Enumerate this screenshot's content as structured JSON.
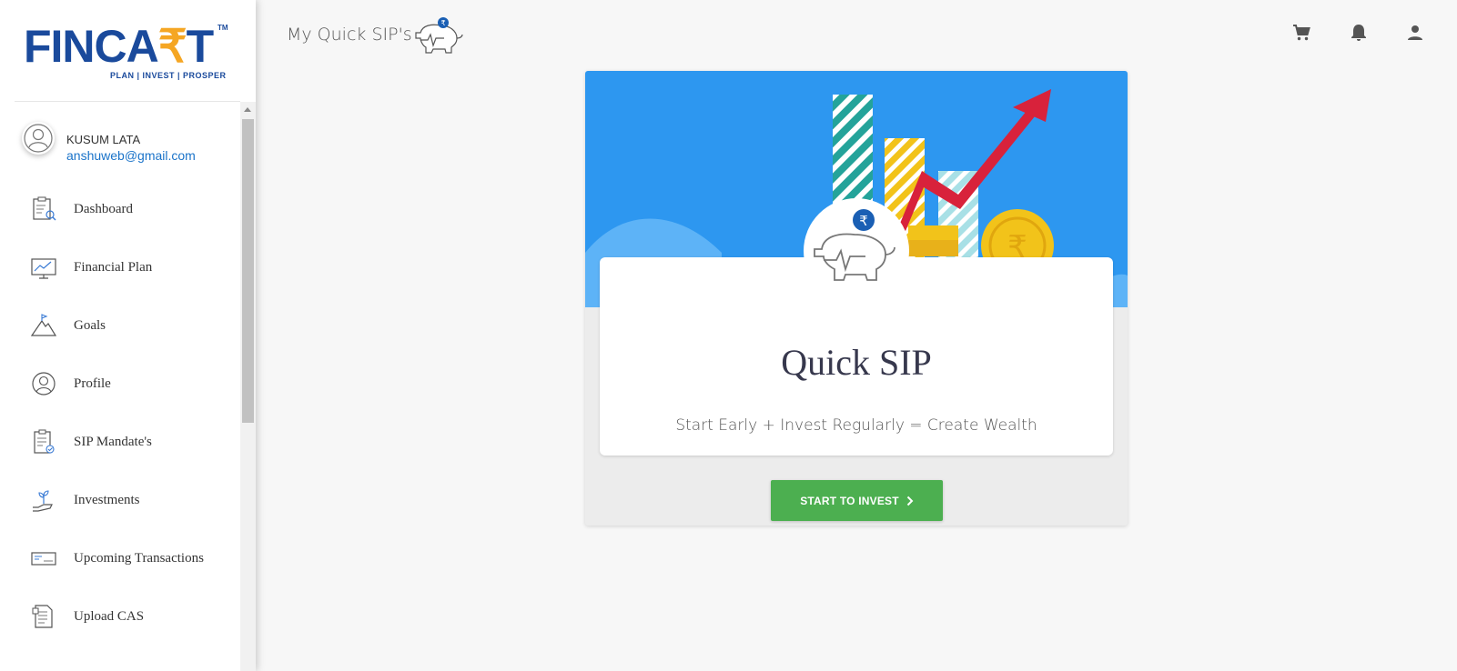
{
  "brand": {
    "name_part1": "FINCA",
    "name_part2": "₹",
    "name_part3": "T",
    "tagline": "PLAN | INVEST | PROSPER",
    "tm": "TM"
  },
  "user": {
    "name": "KUSUM LATA",
    "email": "anshuweb@gmail.com"
  },
  "sidebar": {
    "items": [
      {
        "label": "Dashboard",
        "icon": "dashboard-icon"
      },
      {
        "label": "Financial Plan",
        "icon": "chart-board-icon"
      },
      {
        "label": "Goals",
        "icon": "mountain-flag-icon"
      },
      {
        "label": "Profile",
        "icon": "user-circle-icon"
      },
      {
        "label": "SIP Mandate's",
        "icon": "clipboard-check-icon"
      },
      {
        "label": "Investments",
        "icon": "hand-plant-icon"
      },
      {
        "label": "Upcoming Transactions",
        "icon": "cheque-icon"
      },
      {
        "label": "Upload CAS",
        "icon": "document-upload-icon"
      }
    ]
  },
  "header": {
    "title": "My Quick SIP's",
    "icons": [
      "cart-icon",
      "bell-icon",
      "account-icon"
    ]
  },
  "main": {
    "card_title": "Quick SIP",
    "card_subtitle": "Start Early + Invest Regularly = Create Wealth",
    "cta_label": "START TO INVEST",
    "rupee": "₹"
  },
  "colors": {
    "brand_blue": "#1a4a9c",
    "brand_orange": "#f5a623",
    "hero_blue": "#2d97f0",
    "cta_green": "#4caf50",
    "link_blue": "#1a73c9"
  }
}
